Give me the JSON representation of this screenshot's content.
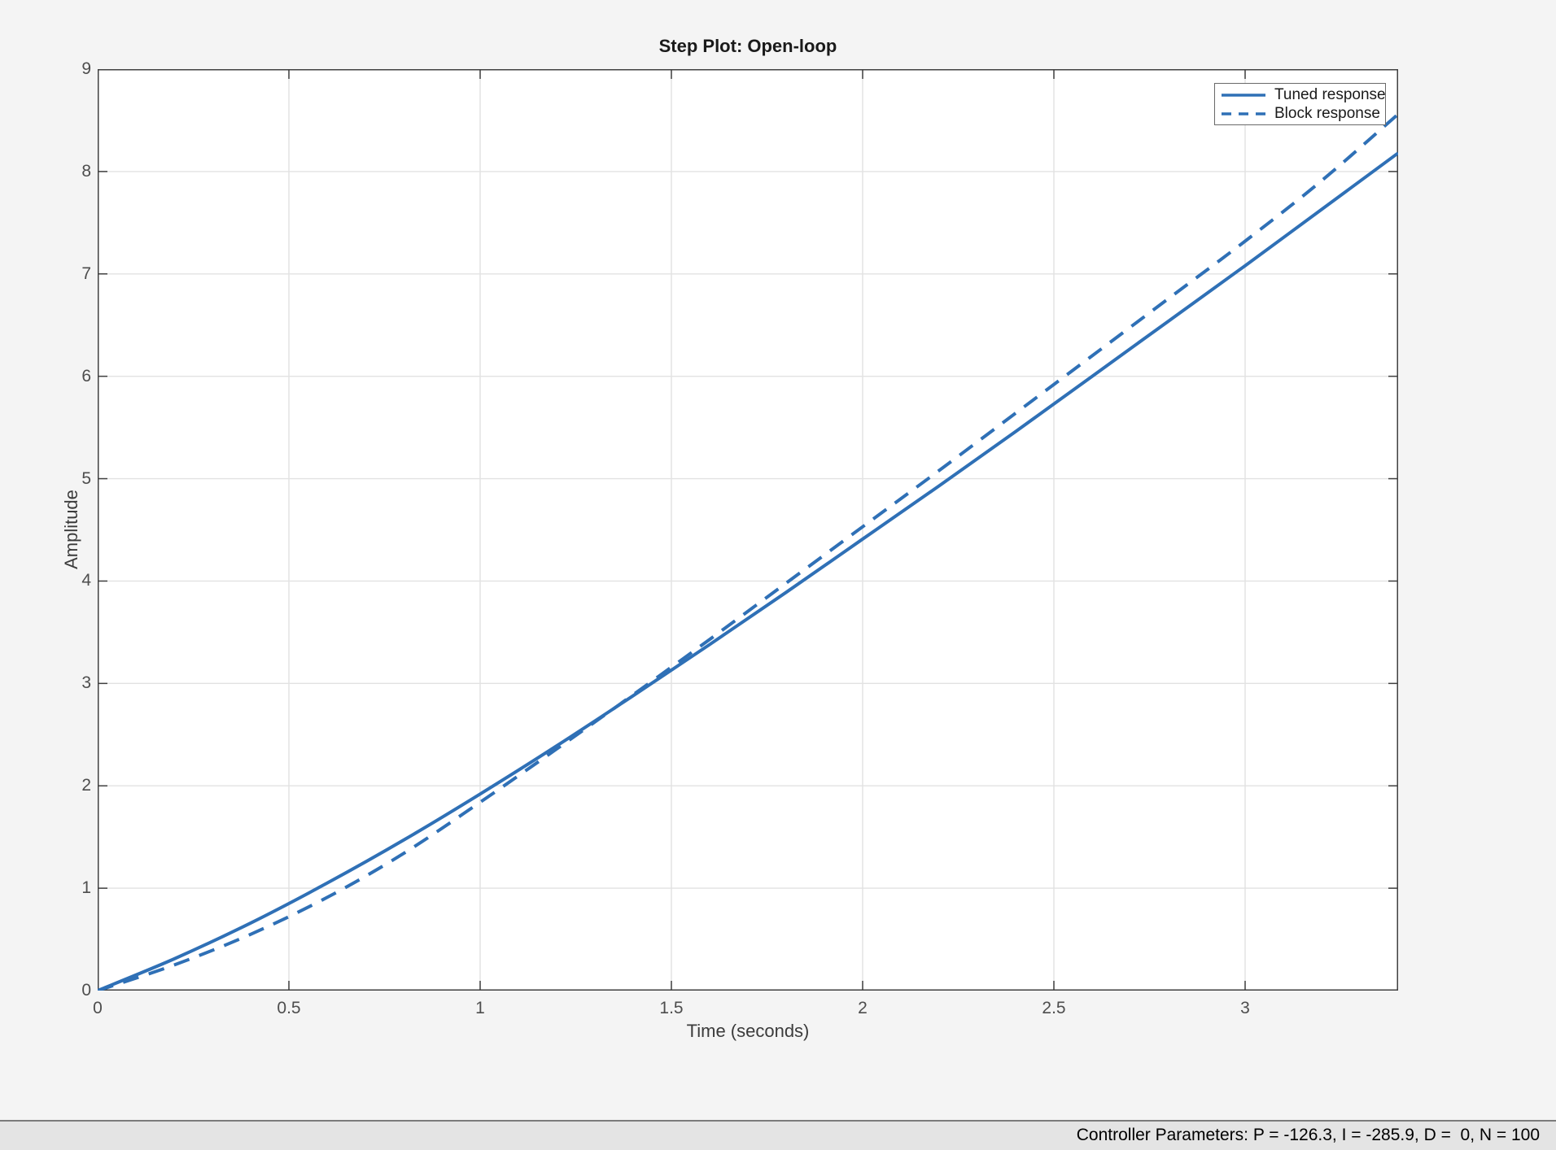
{
  "window": {
    "type": "matlab-figure"
  },
  "status_bar": {
    "text": "Controller Parameters: P = -126.3, I = -285.9, D =  0, N = 100"
  },
  "colors": {
    "accent_blue": "#2F70B6",
    "figure_bg": "#F4F4F4",
    "plot_bg": "#FFFFFF",
    "grid": "#E2E2E2",
    "axis_box": "#404040",
    "tick_label": "#4D4D4D",
    "status_bg": "#E4E4E4"
  },
  "chart_data": {
    "type": "line",
    "title": "Step Plot: Open-loop",
    "xlabel": "Time (seconds)",
    "ylabel": "Amplitude",
    "xlim": [
      0,
      3.4
    ],
    "ylim": [
      0,
      9
    ],
    "xticks": [
      0,
      0.5,
      1,
      1.5,
      2,
      2.5,
      3
    ],
    "yticks": [
      0,
      1,
      2,
      3,
      4,
      5,
      6,
      7,
      8,
      9
    ],
    "grid": true,
    "legend_position": "top-right",
    "x": [
      0,
      0.2,
      0.4,
      0.6,
      0.8,
      1.0,
      1.2,
      1.4,
      1.6,
      1.8,
      2.0,
      2.2,
      2.4,
      2.6,
      2.8,
      3.0,
      3.2,
      3.4
    ],
    "series": [
      {
        "name": "Tuned response",
        "style": "solid",
        "color": "#2F70B6",
        "values": [
          0,
          0.31,
          0.66,
          1.05,
          1.47,
          1.92,
          2.39,
          2.88,
          3.38,
          3.89,
          4.41,
          4.93,
          5.46,
          6.0,
          6.54,
          7.08,
          7.63,
          8.18
        ]
      },
      {
        "name": "Block response",
        "style": "dashed",
        "color": "#2F70B6",
        "values": [
          0,
          0.25,
          0.55,
          0.91,
          1.34,
          1.84,
          2.36,
          2.89,
          3.43,
          3.98,
          4.53,
          5.08,
          5.64,
          6.2,
          6.76,
          7.32,
          7.91,
          8.56
        ]
      }
    ]
  }
}
